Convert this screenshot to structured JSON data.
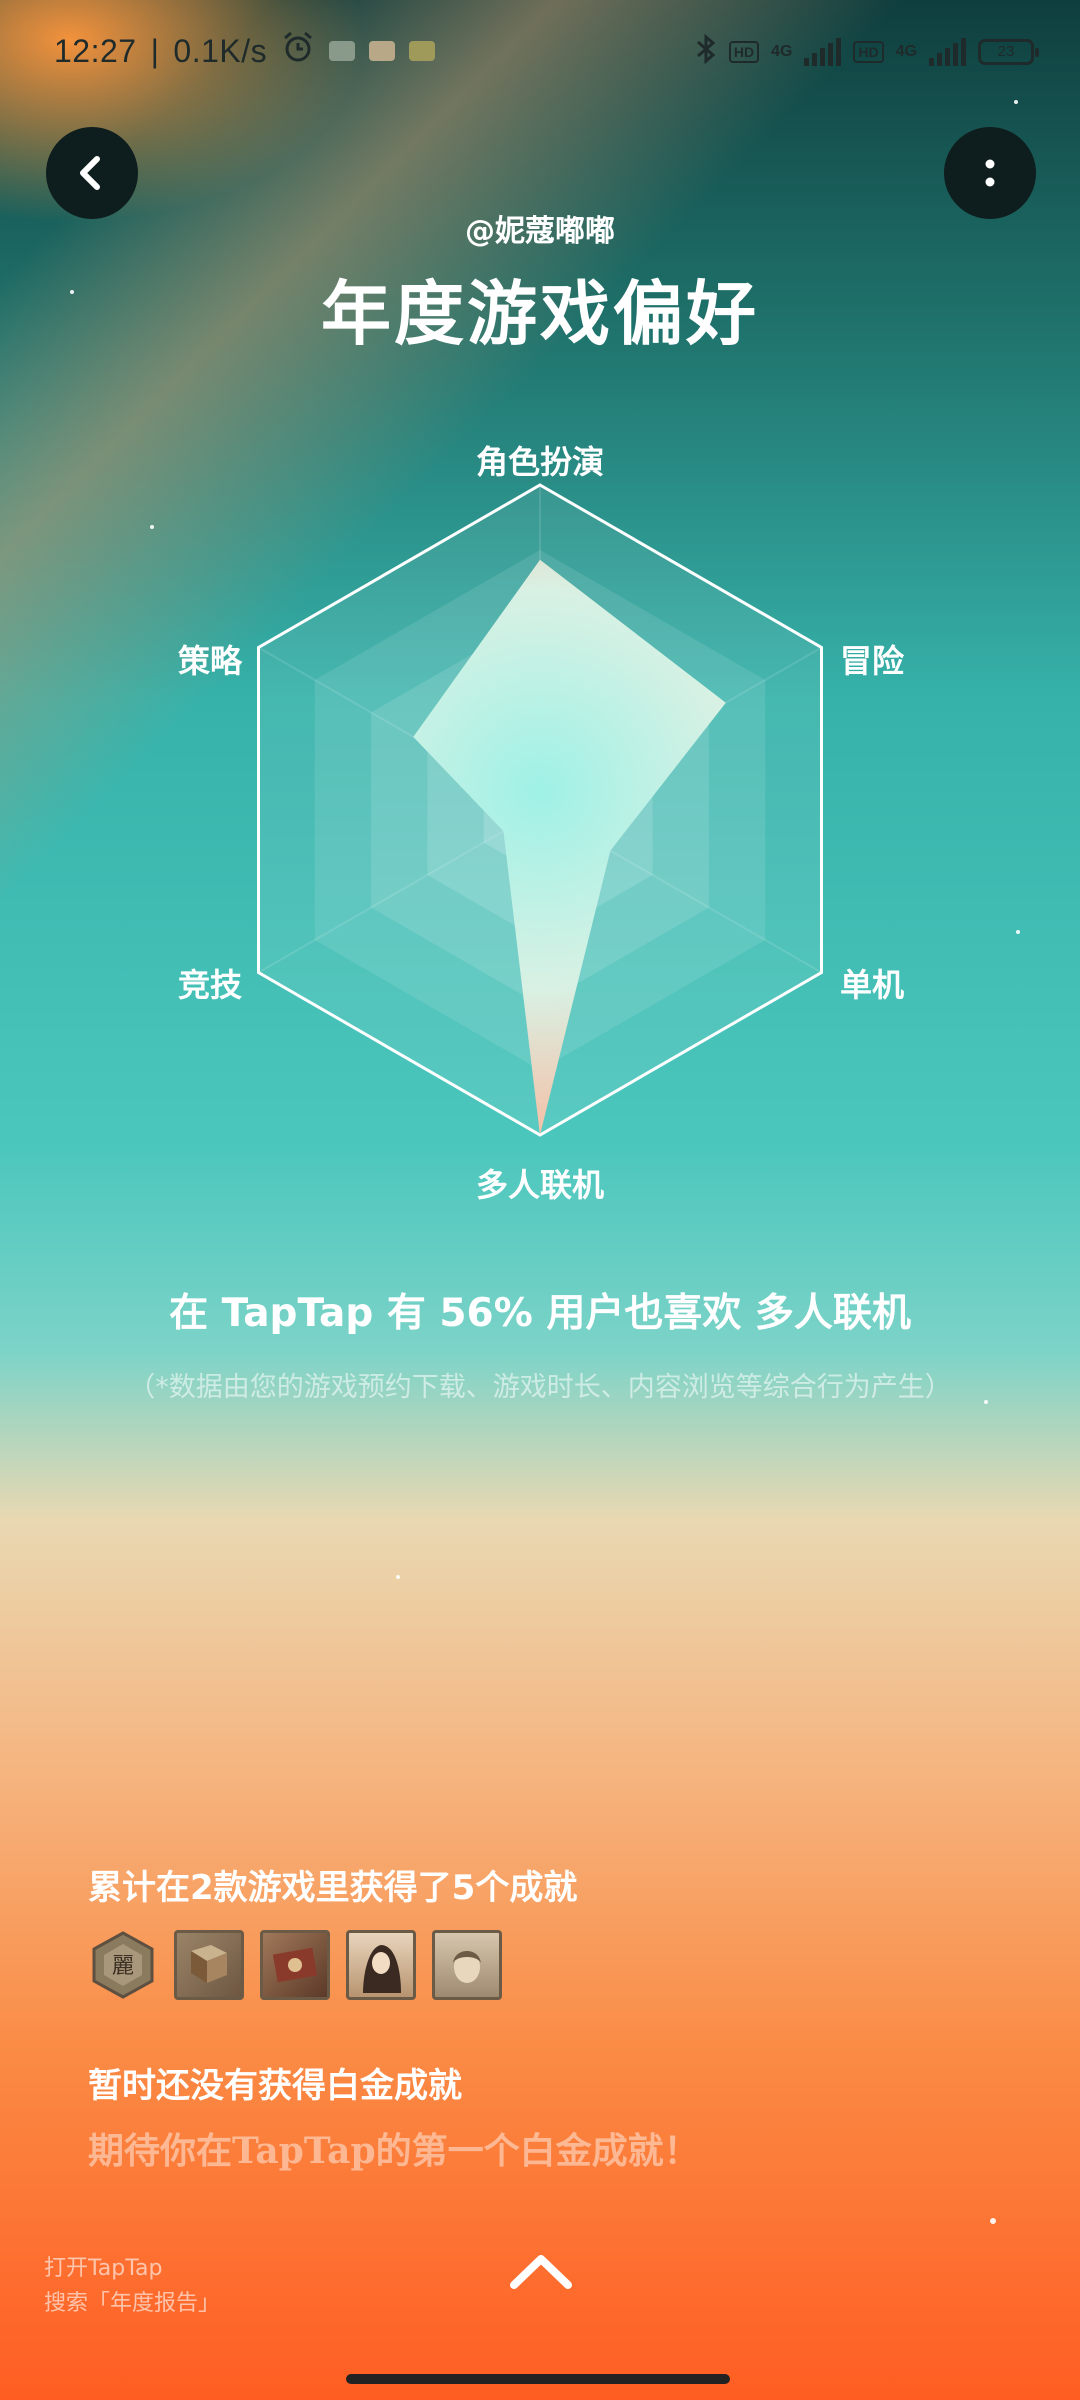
{
  "status_bar": {
    "time": "12:27",
    "speed": "0.1K/s",
    "battery": "23",
    "network": "4G",
    "hd": "HD"
  },
  "header": {
    "username": "@妮蔻嘟嘟",
    "title": "年度游戏偏好"
  },
  "chart_data": {
    "type": "radar",
    "axes": [
      "角色扮演",
      "冒险",
      "单机",
      "多人联机",
      "竞技",
      "策略"
    ],
    "values": [
      0.77,
      0.66,
      0.25,
      1.0,
      0.13,
      0.45
    ],
    "range": [
      0,
      1
    ],
    "colors": {
      "frame": "#ffffff",
      "fill_center": "#9ff1e6",
      "fill_top": "#f1edd8",
      "fill_bottom": "#f7bba0"
    }
  },
  "stat": {
    "line": "在 TapTap 有 56% 用户也喜欢 多人联机",
    "note": "（*数据由您的游戏预约下载、游戏时长、内容浏览等综合行为产生）"
  },
  "achievements": {
    "title": "累计在2款游戏里获得了5个成就",
    "badges": [
      {
        "icon": "hex-emblem-badge-icon",
        "color": "#8a7a5e"
      },
      {
        "icon": "book-badge-icon",
        "color": "#8b6f52"
      },
      {
        "icon": "scroll-map-badge-icon",
        "color": "#7a4a35"
      },
      {
        "icon": "portrait-woman-badge-icon",
        "color": "#c8a886"
      },
      {
        "icon": "portrait-face-badge-icon",
        "color": "#b8a48a"
      }
    ],
    "platinum_title": "暂时还没有获得白金成就",
    "platinum_sub": "期待你在TapTap的第一个白金成就！"
  },
  "footer": {
    "line1": "打开TapTap",
    "line2": "搜索「年度报告」"
  }
}
